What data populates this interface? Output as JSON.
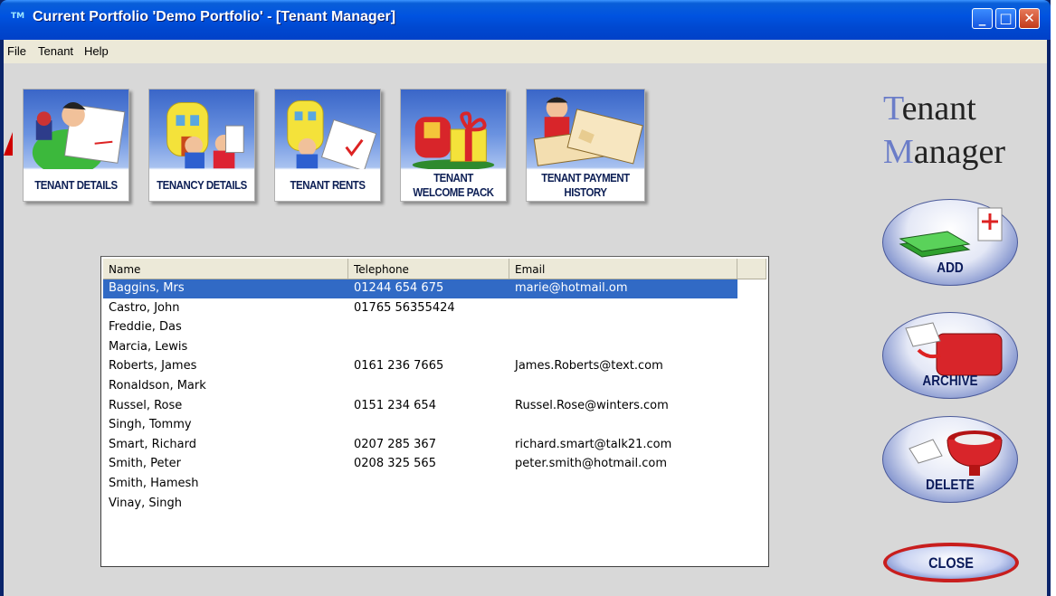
{
  "window": {
    "title": "Current Portfolio 'Demo Portfolio' - [Tenant Manager]",
    "icon_text": "TM"
  },
  "menu": [
    "File",
    "Tenant",
    "Help"
  ],
  "toolbar": [
    {
      "label": "TENANT DETAILS"
    },
    {
      "label": "TENANCY DETAILS"
    },
    {
      "label": "TENANT RENTS"
    },
    {
      "label": "TENANT\nWELCOME PACK"
    },
    {
      "label": "TENANT PAYMENT\nHISTORY"
    }
  ],
  "brand": {
    "line1_initial": "T",
    "line1_rest": "enant",
    "line2_initial": "M",
    "line2_rest": "anager"
  },
  "actions": {
    "add": "ADD",
    "archive": "ARCHIVE",
    "delete": "DELETE",
    "close": "CLOSE"
  },
  "tenant_list": {
    "columns": [
      "Name",
      "Telephone",
      "Email"
    ],
    "rows": [
      {
        "name": "Baggins, Mrs",
        "telephone": "01244 654 675",
        "email": "marie@hotmail.om",
        "selected": true
      },
      {
        "name": "Castro, John",
        "telephone": "01765 56355424",
        "email": ""
      },
      {
        "name": "Freddie, Das",
        "telephone": "",
        "email": ""
      },
      {
        "name": "Marcia, Lewis",
        "telephone": "",
        "email": ""
      },
      {
        "name": "Roberts, James",
        "telephone": "0161 236 7665",
        "email": "James.Roberts@text.com"
      },
      {
        "name": "Ronaldson, Mark",
        "telephone": "",
        "email": ""
      },
      {
        "name": "Russel, Rose",
        "telephone": "0151 234 654",
        "email": "Russel.Rose@winters.com"
      },
      {
        "name": "Singh, Tommy",
        "telephone": "",
        "email": ""
      },
      {
        "name": "Smart, Richard",
        "telephone": "0207 285 367",
        "email": "richard.smart@talk21.com"
      },
      {
        "name": "Smith, Peter",
        "telephone": "0208 325 565",
        "email": "peter.smith@hotmail.com"
      },
      {
        "name": "Smith, Hamesh",
        "telephone": "",
        "email": ""
      },
      {
        "name": "Vinay, Singh",
        "telephone": "",
        "email": ""
      }
    ]
  },
  "colors": {
    "titlebar": "#0053e0",
    "selection": "#316ac5",
    "client_bg": "#d8d8d8",
    "close_border": "#c81e1e"
  }
}
